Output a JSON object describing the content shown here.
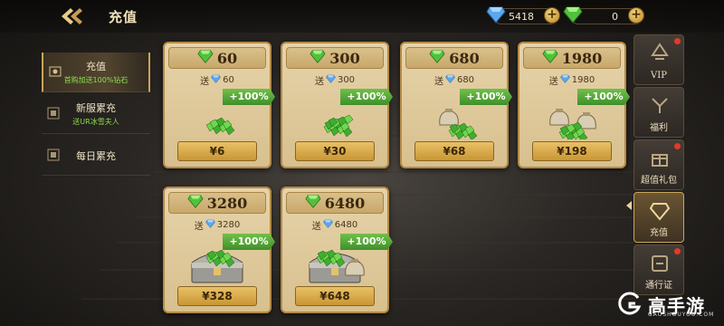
{
  "header": {
    "title": "充值",
    "blue_gem_count": "5418",
    "green_gem_count": "0",
    "plus_label": "+"
  },
  "left_menu": [
    {
      "title": "充值",
      "subtitle": "首购加送100%钻石",
      "active": true
    },
    {
      "title": "新服累充",
      "subtitle": "送UR冰雪夫人",
      "active": false
    },
    {
      "title": "每日累充",
      "subtitle": "",
      "active": false
    }
  ],
  "cards": [
    {
      "amount": "60",
      "bonus_prefix": "送",
      "bonus": "60",
      "tag": "+100%",
      "price": "¥6",
      "art": "gems-small"
    },
    {
      "amount": "300",
      "bonus_prefix": "送",
      "bonus": "300",
      "tag": "+100%",
      "price": "¥30",
      "art": "gems-pile"
    },
    {
      "amount": "680",
      "bonus_prefix": "送",
      "bonus": "680",
      "tag": "+100%",
      "price": "¥68",
      "art": "gem-bag"
    },
    {
      "amount": "1980",
      "bonus_prefix": "送",
      "bonus": "1980",
      "tag": "+100%",
      "price": "¥198",
      "art": "gem-bags"
    },
    {
      "amount": "3280",
      "bonus_prefix": "送",
      "bonus": "3280",
      "tag": "+100%",
      "price": "¥328",
      "art": "gem-chest"
    },
    {
      "amount": "6480",
      "bonus_prefix": "送",
      "bonus": "6480",
      "tag": "+100%",
      "price": "¥648",
      "art": "gem-chest-bags"
    }
  ],
  "right_tabs": [
    {
      "label": "VIP",
      "icon": "vip-icon",
      "badge": true
    },
    {
      "label": "福利",
      "icon": "welfare-icon",
      "badge": false
    },
    {
      "label": "超值礼包",
      "icon": "gift-pack-icon",
      "badge": true
    },
    {
      "label": "充值",
      "icon": "recharge-icon",
      "badge": false,
      "active": true
    },
    {
      "label": "通行证",
      "icon": "pass-icon",
      "badge": true
    }
  ],
  "watermark": {
    "text": "高手游",
    "subtext": "GAOSHOUYOU.COM"
  },
  "colors": {
    "gold": "#c9a55a",
    "green_gem": "#4fc23a",
    "blue_gem": "#5aa8ee",
    "badge_red": "#e23a2a"
  }
}
